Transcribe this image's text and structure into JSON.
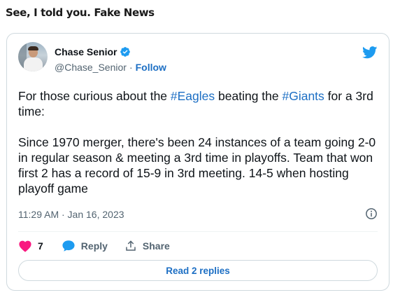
{
  "post": {
    "title": "See, I told you. Fake News"
  },
  "tweet": {
    "author": {
      "display_name": "Chase Senior",
      "handle": "@Chase_Senior",
      "separator": "·",
      "follow_label": "Follow",
      "verified": true
    },
    "text": {
      "segments": [
        {
          "t": "For those curious about the ",
          "tag": false
        },
        {
          "t": "#Eagles",
          "tag": true
        },
        {
          "t": " beating the ",
          "tag": false
        },
        {
          "t": "#Giants",
          "tag": true
        },
        {
          "t": " for a 3rd time:\n\nSince 1970 merger, there's been 24 instances of a team going 2-0 in regular season & meeting a 3rd time in playoffs. Team that won first 2 has a record of 15-9 in 3rd meeting. 14-5 when hosting playoff game",
          "tag": false
        }
      ]
    },
    "timestamp": "11:29 AM · Jan 16, 2023",
    "likes": "7",
    "reply_label": "Reply",
    "share_label": "Share",
    "read_replies_label": "Read 2 replies"
  },
  "icons": {
    "verified": "verified-badge-icon",
    "bird": "twitter-bird-icon",
    "info": "info-icon",
    "heart": "heart-icon",
    "reply": "reply-bubble-icon",
    "share": "share-icon"
  },
  "colors": {
    "link": "#1d6fc4",
    "twitter_blue": "#1d9bf0",
    "like_red": "#f91880",
    "muted": "#536471",
    "border": "#cfd9de"
  }
}
